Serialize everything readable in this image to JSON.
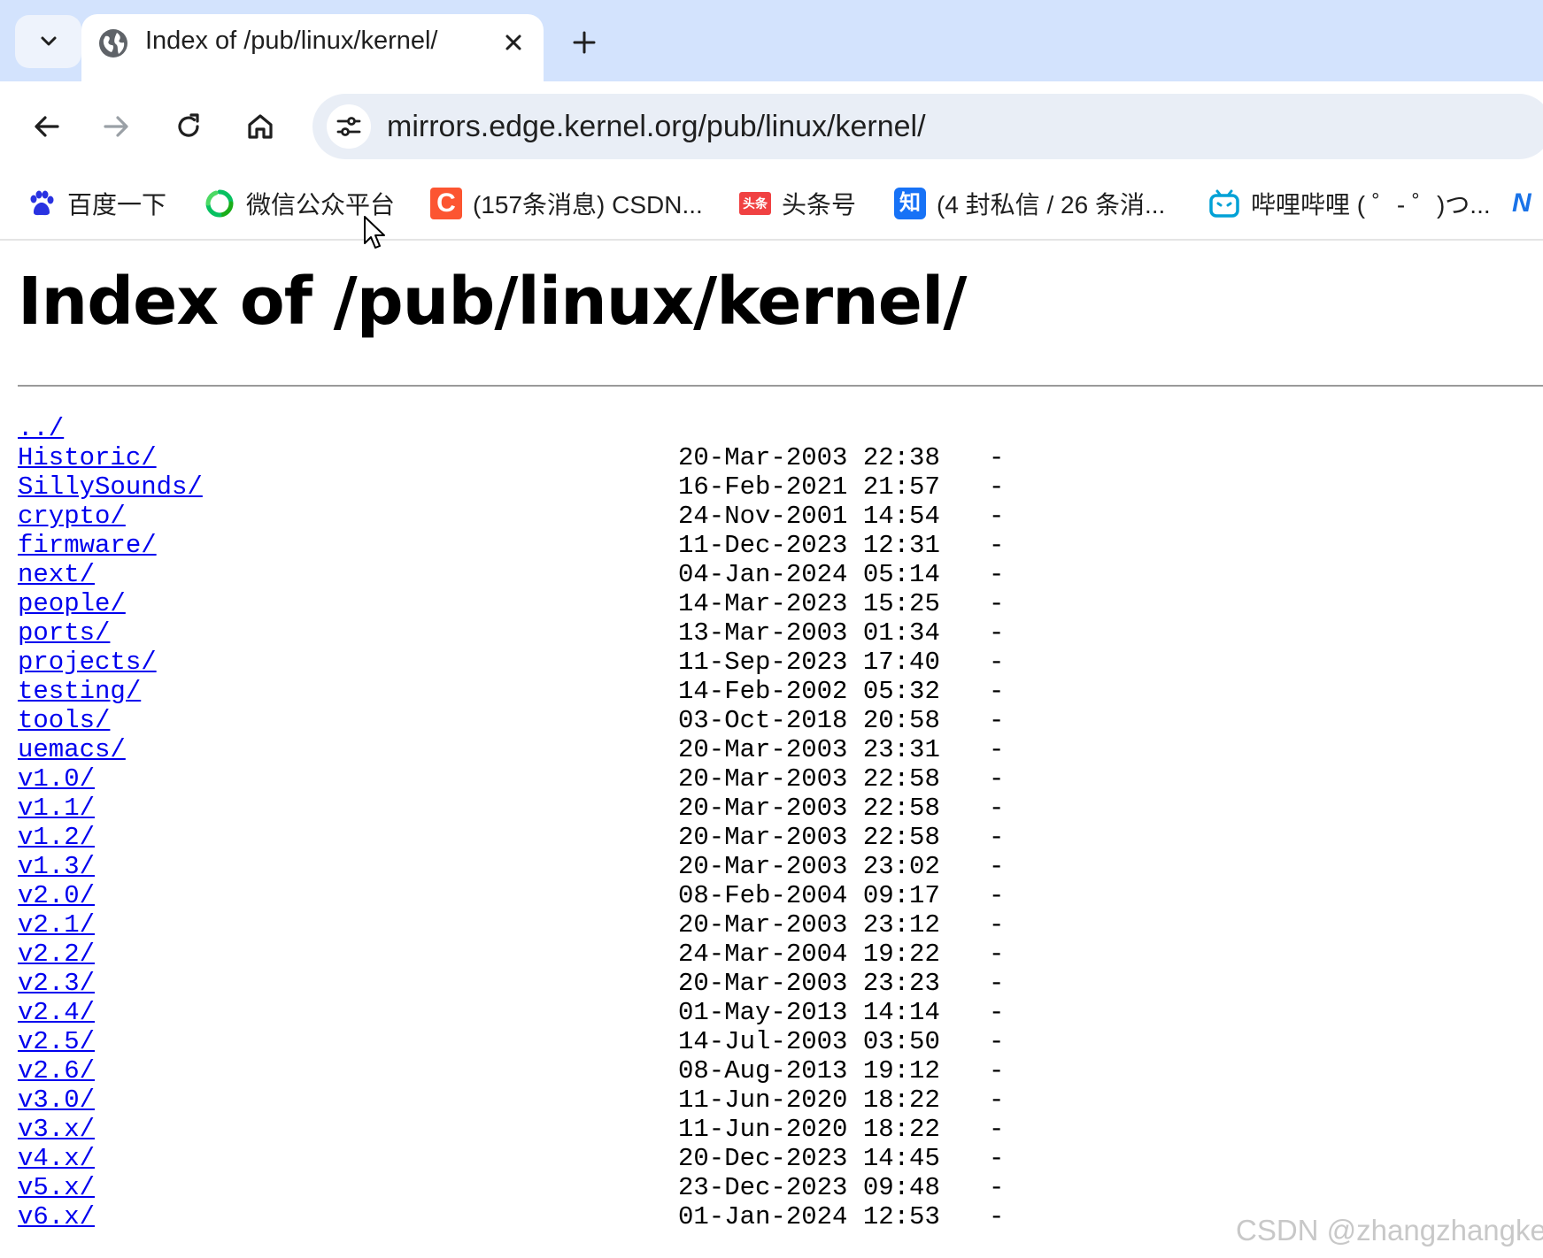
{
  "browser": {
    "tab": {
      "title": "Index of /pub/linux/kernel/"
    },
    "address_bar": {
      "url": "mirrors.edge.kernel.org/pub/linux/kernel/"
    },
    "bookmarks": [
      {
        "label": "百度一下",
        "icon": "baidu-paw-icon"
      },
      {
        "label": "微信公众平台",
        "icon": "wechat-official-icon"
      },
      {
        "label": "(157条消息) CSDN...",
        "icon": "csdn-icon",
        "icon_text": "C"
      },
      {
        "label": "头条号",
        "icon": "toutiao-icon",
        "icon_text": "头条"
      },
      {
        "label": "(4 封私信 / 26 条消...",
        "icon": "zhihu-icon",
        "icon_text": "知"
      },
      {
        "label": "哔哩哔哩 ( ゜- ゜)つ...",
        "icon": "bilibili-icon"
      }
    ]
  },
  "page": {
    "heading": "Index of /pub/linux/kernel/",
    "parent_link": "../",
    "entries": [
      {
        "name": "Historic/",
        "date": "20-Mar-2003 22:38",
        "size": "-"
      },
      {
        "name": "SillySounds/",
        "date": "16-Feb-2021 21:57",
        "size": "-"
      },
      {
        "name": "crypto/",
        "date": "24-Nov-2001 14:54",
        "size": "-"
      },
      {
        "name": "firmware/",
        "date": "11-Dec-2023 12:31",
        "size": "-"
      },
      {
        "name": "next/",
        "date": "04-Jan-2024 05:14",
        "size": "-"
      },
      {
        "name": "people/",
        "date": "14-Mar-2023 15:25",
        "size": "-"
      },
      {
        "name": "ports/",
        "date": "13-Mar-2003 01:34",
        "size": "-"
      },
      {
        "name": "projects/",
        "date": "11-Sep-2023 17:40",
        "size": "-"
      },
      {
        "name": "testing/",
        "date": "14-Feb-2002 05:32",
        "size": "-"
      },
      {
        "name": "tools/",
        "date": "03-Oct-2018 20:58",
        "size": "-"
      },
      {
        "name": "uemacs/",
        "date": "20-Mar-2003 23:31",
        "size": "-"
      },
      {
        "name": "v1.0/",
        "date": "20-Mar-2003 22:58",
        "size": "-"
      },
      {
        "name": "v1.1/",
        "date": "20-Mar-2003 22:58",
        "size": "-"
      },
      {
        "name": "v1.2/",
        "date": "20-Mar-2003 22:58",
        "size": "-"
      },
      {
        "name": "v1.3/",
        "date": "20-Mar-2003 23:02",
        "size": "-"
      },
      {
        "name": "v2.0/",
        "date": "08-Feb-2004 09:17",
        "size": "-"
      },
      {
        "name": "v2.1/",
        "date": "20-Mar-2003 23:12",
        "size": "-"
      },
      {
        "name": "v2.2/",
        "date": "24-Mar-2004 19:22",
        "size": "-"
      },
      {
        "name": "v2.3/",
        "date": "20-Mar-2003 23:23",
        "size": "-"
      },
      {
        "name": "v2.4/",
        "date": "01-May-2013 14:14",
        "size": "-"
      },
      {
        "name": "v2.5/",
        "date": "14-Jul-2003 03:50",
        "size": "-"
      },
      {
        "name": "v2.6/",
        "date": "08-Aug-2013 19:12",
        "size": "-"
      },
      {
        "name": "v3.0/",
        "date": "11-Jun-2020 18:22",
        "size": "-"
      },
      {
        "name": "v3.x/",
        "date": "11-Jun-2020 18:22",
        "size": "-"
      },
      {
        "name": "v4.x/",
        "date": "20-Dec-2023 14:45",
        "size": "-"
      },
      {
        "name": "v5.x/",
        "date": "23-Dec-2023 09:48",
        "size": "-"
      },
      {
        "name": "v6.x/",
        "date": "01-Jan-2024 12:53",
        "size": "-"
      }
    ]
  },
  "watermark": "CSDN @zhangzhangkeji",
  "colors": {
    "tabstrip": "#d3e3fd",
    "omnibox": "#e9eef6",
    "link": "#0000ee",
    "csdn": "#fc5531",
    "toutiao": "#f04142",
    "zhihu": "#1772f6",
    "bilibili": "#00a1d6",
    "baidu": "#2932e1",
    "wechat": "#07c160"
  }
}
